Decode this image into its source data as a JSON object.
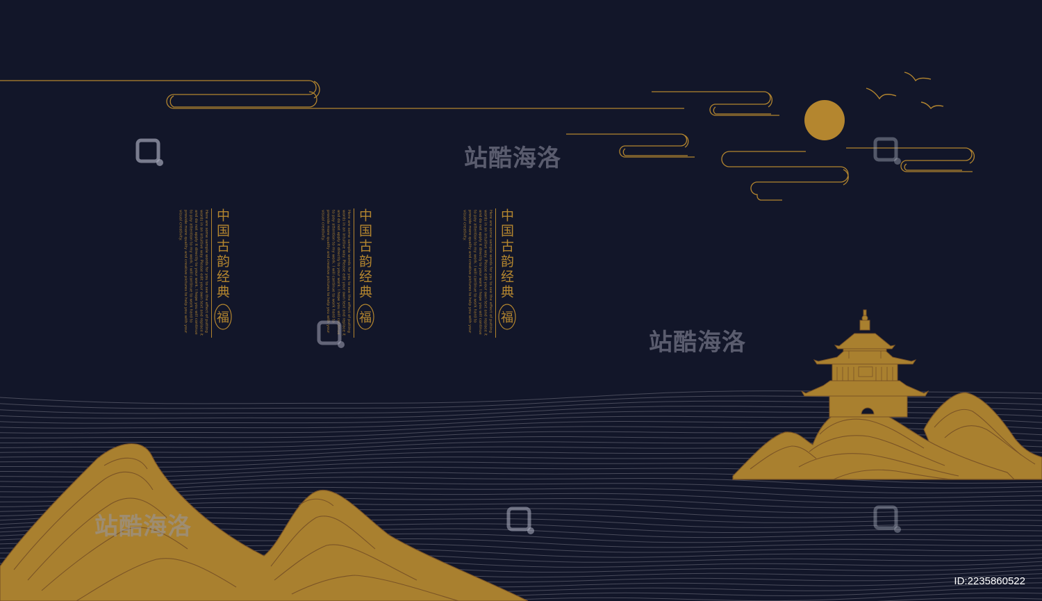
{
  "colors": {
    "background": "#121629",
    "gold": "#b4862f",
    "gold_fill": "#a9802f",
    "mountain_line": "#7a5326",
    "wave_line": "#4a4c5c"
  },
  "panels": [
    {
      "title": "中国古韵经典",
      "seal_glyph": "福",
      "body": "Here are some sample words for you to see the effect of putting words in an intuitive way. Please edit your own text and replace it and do not apply it directly to your work. I hope you will continue to pay attention to my work. I will continue to work hard to provide more quality and creative pictures to help you with your visual creativity."
    },
    {
      "title": "中国古韵经典",
      "seal_glyph": "福",
      "body": "Here are some sample words for you to see the effect of putting words in an intuitive way. Please edit your own text and replace it and do not apply it directly to your work. I hope you will continue to pay attention to my work. I will continue to work hard to provide more quality and creative pictures to help you with your visual creativity."
    },
    {
      "title": "中国古韵经典",
      "seal_glyph": "福",
      "body": "Here are some sample words for you to see the effect of putting words in an intuitive way. Please edit your own text and replace it and do not apply it directly to your work. I hope you will continue to pay attention to my work. I will continue to work hard to provide more quality and creative pictures to help you with your visual creativity."
    }
  ],
  "watermark": {
    "text": "站酷海洛"
  },
  "image_id": "ID:2235860522",
  "icons": [
    "moon-icon",
    "bird-icon",
    "pavilion-icon",
    "seal-icon",
    "watermark-logo-icon",
    "cloud-icon",
    "mountain-icon"
  ]
}
